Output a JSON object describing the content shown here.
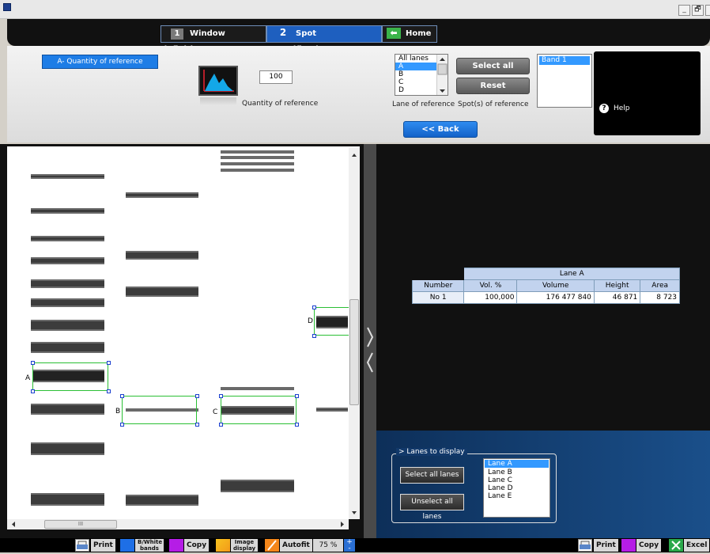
{
  "window": {
    "minimize_glyph": "_",
    "restore_glyph": "🗗",
    "close_glyph": "×"
  },
  "nav": {
    "tab1": {
      "number": "1",
      "label": "Window definition"
    },
    "tab2": {
      "number": "2",
      "label": "Spot quantification"
    },
    "home": {
      "icon": "arrow-left-icon",
      "glyph": "⬅",
      "label": "Home"
    }
  },
  "controls": {
    "quantity_tab": "A- Quantity of reference",
    "quantity_value": "100",
    "quantity_label": "Quantity of reference",
    "lanes_list": [
      "All lanes",
      "A",
      "B",
      "C",
      "D"
    ],
    "lanes_selected_index": 1,
    "lane_ref_label": "Lane of reference",
    "spot_ref_label": "Spot(s) of reference",
    "select_all": "Select all",
    "reset": "Reset",
    "bands": [
      "Band 1"
    ],
    "help_icon": "?",
    "help": "Help",
    "back": "<< Back"
  },
  "gel": {
    "box_labels": {
      "A": "A",
      "B": "B",
      "C": "C",
      "D": "D"
    },
    "hscroll_grip": "III"
  },
  "results": {
    "table": {
      "lane": "Lane A",
      "columns": [
        "Number",
        "Vol. %",
        "Volume",
        "Height",
        "Area"
      ],
      "rows": [
        [
          "No 1",
          "100,000",
          "176 477 840",
          "46 871",
          "8 723"
        ]
      ]
    },
    "lanes_to_display_title": "> Lanes to display",
    "select_all_lanes": "Select all lanes",
    "unselect_all_lanes": "Unselect all lanes",
    "lanes": [
      "Lane A",
      "Lane B",
      "Lane C",
      "Lane D",
      "Lane E"
    ],
    "lanes_selected_index": 0
  },
  "toolbar_left": {
    "print": "Print",
    "bw_bands": "B/White bands",
    "copy": "Copy",
    "image_display": "Image display",
    "autofit": "Autofit",
    "zoom": "75 %"
  },
  "toolbar_right": {
    "print": "Print",
    "copy": "Copy",
    "excel": "Excel"
  },
  "colors": {
    "accent_blue": "#1e7de6",
    "nav_active": "#1e5fbf",
    "box_green": "#2bbf35",
    "handle_blue": "#1a3fcf"
  }
}
